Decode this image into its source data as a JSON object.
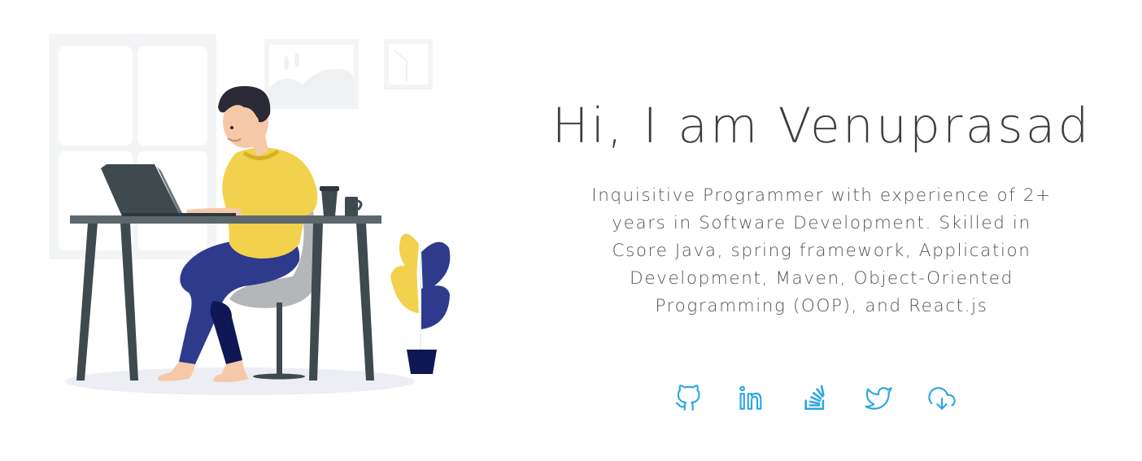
{
  "hero": {
    "title": "Hi, I am Venuprasad",
    "bio": "Inquisitive Programmer with experience of 2+ years in Software Development. Skilled in Csore Java, spring framework, Application Development, Maven, Object-Oriented Programming (OOP), and React.js"
  },
  "socials": [
    {
      "icon": "github-icon"
    },
    {
      "icon": "linkedin-icon"
    },
    {
      "icon": "stackoverflow-icon"
    },
    {
      "icon": "twitter-icon"
    },
    {
      "icon": "cloud-download-icon"
    }
  ],
  "colors": {
    "accent": "#2aa6e4",
    "text": "#3d3d3d",
    "shirt": "#f2d14c",
    "pants": "#2e3a8c",
    "desk": "#3f4a4f",
    "leaf_yellow": "#f2d14c",
    "leaf_blue": "#2e3a8c"
  }
}
